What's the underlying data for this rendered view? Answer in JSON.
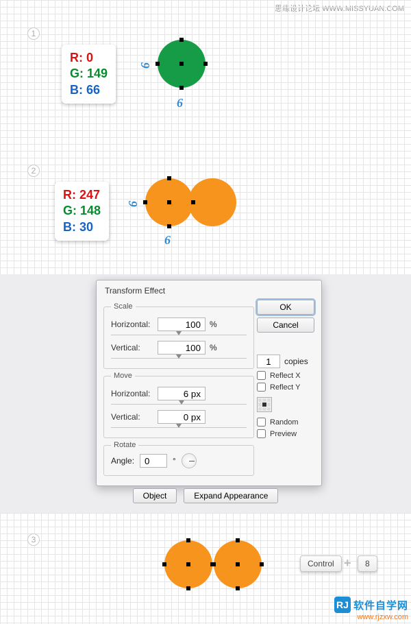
{
  "watermark": {
    "top_cn": "思缘设计论坛",
    "top_url": "WWW.MISSYUAN.COM",
    "bottom_brand": "软件自学网",
    "bottom_url": "www.rjzxw.com"
  },
  "steps": {
    "s1": "1",
    "s2": "2",
    "s3": "3"
  },
  "rgb1": {
    "r": "R: 0",
    "g": "G: 149",
    "b": "B: 66"
  },
  "rgb2": {
    "r": "R: 247",
    "g": "G: 148",
    "b": "B: 30"
  },
  "dim": {
    "w": "6",
    "h": "6"
  },
  "colors": {
    "green": "#169b46",
    "orange": "#f7941e"
  },
  "dialog": {
    "title": "Transform Effect",
    "scale": {
      "legend": "Scale",
      "h_label": "Horizontal:",
      "v_label": "Vertical:",
      "h_val": "100",
      "v_val": "100",
      "pct": "%"
    },
    "move": {
      "legend": "Move",
      "h_label": "Horizontal:",
      "v_label": "Vertical:",
      "h_val": "6 px",
      "v_val": "0 px"
    },
    "rotate": {
      "legend": "Rotate",
      "label": "Angle:",
      "value": "0",
      "deg": "°"
    },
    "ok": "OK",
    "cancel": "Cancel",
    "copies_val": "1",
    "copies_label": "copies",
    "reflect_x": "Reflect X",
    "reflect_y": "Reflect Y",
    "random": "Random",
    "preview": "Preview"
  },
  "menu": {
    "object": "Object",
    "expand": "Expand Appearance"
  },
  "keys": {
    "control": "Control",
    "eight": "8"
  }
}
